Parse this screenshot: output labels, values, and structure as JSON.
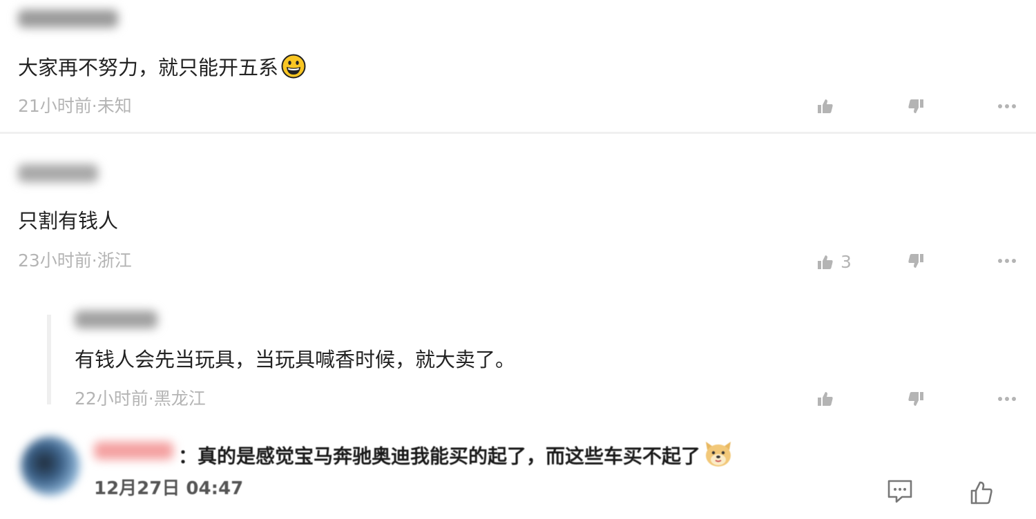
{
  "comments": [
    {
      "text": "大家再不努力，就只能开五系",
      "emoji_icon": "grinning-face-emoji",
      "meta": "21小时前·未知",
      "like_count": "",
      "username_blurred": true
    },
    {
      "text": "只割有钱人",
      "meta": "23小时前·浙江",
      "like_count": "3",
      "username_blurred": true
    }
  ],
  "reply": {
    "text": "有钱人会先当玩具，当玩具喊香时候，就大卖了。",
    "meta": "22小时前·黑龙江",
    "username_blurred": true
  },
  "bottom_comment": {
    "separator": "：",
    "text": "真的是感觉宝马奔驰奥迪我能买的起了，而这些车买不起了",
    "emoji_icon": "doge-face-emoji",
    "time": "12月27日 04:47",
    "username_blurred": true
  },
  "icons": {
    "like": "thumbs-up-icon",
    "dislike": "thumbs-down-icon",
    "more": "more-dots-icon",
    "comment": "comment-bubble-icon"
  },
  "colors": {
    "text": "#222222",
    "meta": "#b4b4b4",
    "divider": "#f0f0f0",
    "emoji_yellow": "#f9c623"
  }
}
